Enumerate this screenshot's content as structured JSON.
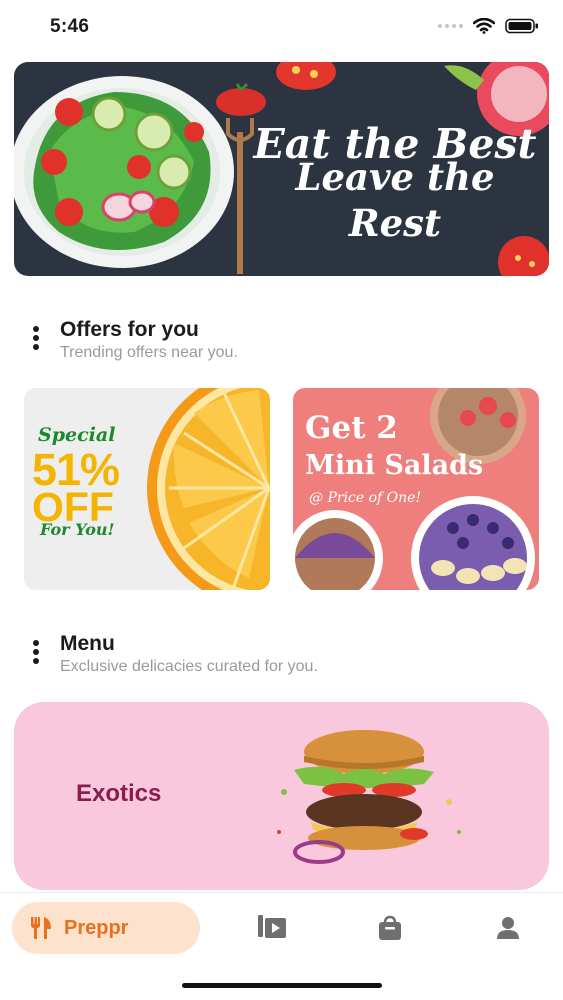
{
  "status_bar": {
    "time": "5:46"
  },
  "hero": {
    "line1": "Eat the Best",
    "line2": "Leave the Rest"
  },
  "offers_section": {
    "title": "Offers for you",
    "subtitle": "Trending offers near you."
  },
  "offers": [
    {
      "special": "Special",
      "percent": "51%",
      "off": "OFF",
      "for_you": "For You!"
    },
    {
      "line1": "Get 2",
      "line2": "Mini Salads",
      "line3": "@ Price of One!"
    }
  ],
  "menu_section": {
    "title": "Menu",
    "subtitle": "Exclusive delicacies curated for you."
  },
  "menu_items": [
    {
      "label": "Exotics"
    }
  ],
  "bottom_nav": {
    "active_label": "Preppr",
    "items": [
      {
        "icon": "fork-knife-icon"
      },
      {
        "icon": "video-library-icon"
      },
      {
        "icon": "shopping-bag-icon"
      },
      {
        "icon": "person-icon"
      }
    ]
  },
  "colors": {
    "accent": "#e8711c",
    "accent_bg": "#fde3ce",
    "hero_bg": "#2b3440",
    "menu_card_bg": "#f9c8dc",
    "menu_label": "#8a1d50",
    "offer2_bg": "#ef7f7c",
    "offer1_text": "#f5b400"
  }
}
